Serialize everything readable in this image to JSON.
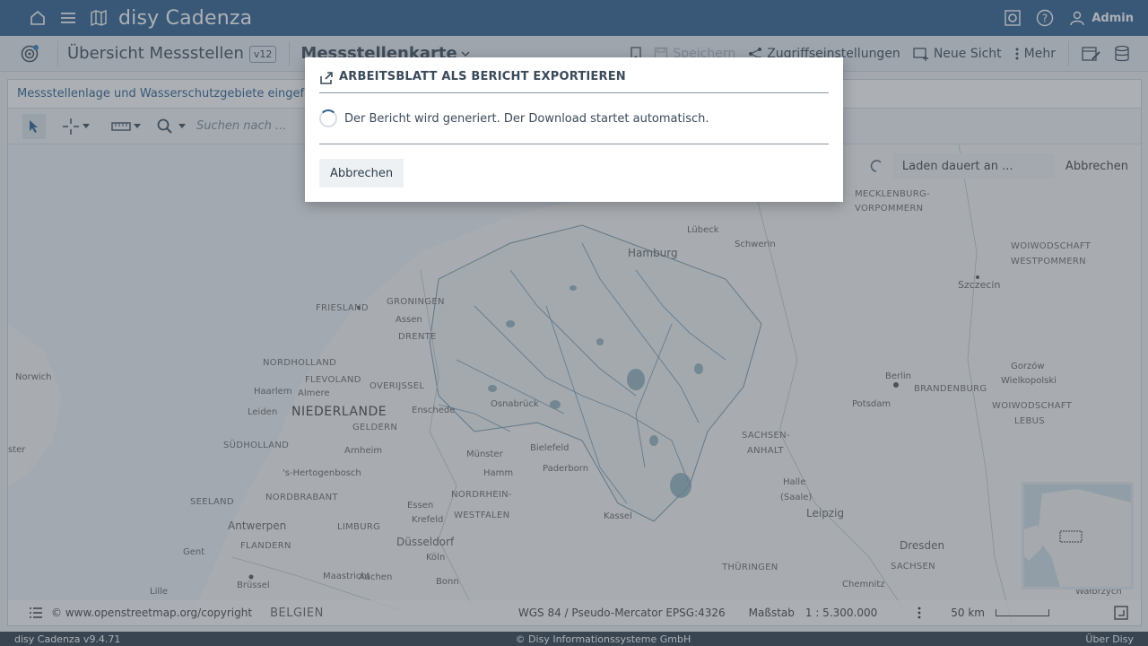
{
  "appbar": {
    "brand": "disy Cadenza",
    "user": "Admin",
    "icons": [
      "home-icon",
      "menu-icon",
      "map-icon",
      "settings-icon",
      "help-icon",
      "user-icon"
    ]
  },
  "toolbar": {
    "workbook_title": "Übersicht Messstellen",
    "version": "v12",
    "view_title": "Messstellenkarte",
    "save_label": "Speichern",
    "access_label": "Zugriffseinstellungen",
    "new_view_label": "Neue Sicht",
    "more_label": "Mehr"
  },
  "panel": {
    "title": "Messstellenlage und Wasserschutzgebiete eingefärbt",
    "search_placeholder": "Suchen nach ...",
    "loading_text": "Laden dauert an ...",
    "loading_cancel": "Abbrechen"
  },
  "map": {
    "labels": {
      "hamburg": "Hamburg",
      "lubeck": "Lübeck",
      "schwerin": "Schwerin",
      "mv1": "MECKLENBURG-",
      "mv2": "VORPOMMERN",
      "groningen": "GRONINGEN",
      "friesland": "FRIESLAND",
      "assen": "Assen",
      "drente": "DRENTE",
      "nordholland": "NORDHOLLAND",
      "flevoland": "FLEVOLAND",
      "overijssel": "OVERIJSSEL",
      "haarlem": "Haarlem",
      "almere": "Almere",
      "niederlande": "NIEDERLANDE",
      "leiden": "Leiden",
      "geldern": "GELDERN",
      "enschede": "Enschede",
      "osnabruck": "Osnabrück",
      "sudholland": "SÜDHOLLAND",
      "arnheim": "Arnheim",
      "shertogenbosch": "'s-Hertogenbosch",
      "munster": "Münster",
      "bielefeld": "Bielefeld",
      "paderborn": "Paderborn",
      "hamm": "Hamm",
      "seeland": "SEELAND",
      "nordbrabant": "NORDBRABANT",
      "nrw1": "NORDRHEIN-",
      "nrw2": "WESTFALEN",
      "essen": "Essen",
      "krefeld": "Krefeld",
      "antwerpen": "Antwerpen",
      "limburg": "LIMBURG",
      "flandern": "FLANDERN",
      "gent": "Gent",
      "dusseldorf": "Düsseldorf",
      "koln": "Köln",
      "brussel": "Brüssel",
      "maastricht": "Maastricht",
      "aachen": "Aachen",
      "bonn": "Bonn",
      "lille": "Lille",
      "kassel": "Kassel",
      "sa1": "SACHSEN-",
      "sa2": "ANHALT",
      "halle": "Halle",
      "saale": "(Saale)",
      "leipzig": "Leipzig",
      "dresden": "Dresden",
      "sachsen": "SACHSEN",
      "thuringen": "THÜRINGEN",
      "chemnitz": "Chemnitz",
      "berlin": "Berlin",
      "potsdam": "Potsdam",
      "brandenburg": "BRANDENBURG",
      "szczecin": "Szczecin",
      "woi1": "WOIWODSCHAFT",
      "woi2": "WESTPOMMERN",
      "gorzow": "Gorzów",
      "wielkopolski": "Wielkopolski",
      "woi3": "WOIWODSCHAFT",
      "woi4": "LEBUS",
      "norwich": "Norwich",
      "ster": "ster",
      "walbrzych": "Wałbrzych"
    },
    "footer": {
      "copyright": "© www.openstreetmap.org/copyright",
      "belgien": "BELGIEN",
      "crs": "WGS 84 / Pseudo-Mercator EPSG:4326",
      "scale_label": "Maßstab",
      "scale_value": "1 : 5.300.000",
      "scalebar_label": "50 km"
    }
  },
  "dialog": {
    "title": "ARBEITSBLATT ALS BERICHT EXPORTIEREN",
    "message": "Der Bericht wird generiert. Der Download startet automatisch.",
    "cancel_label": "Abbrechen"
  },
  "statusbar": {
    "version": "disy Cadenza v9.4.71",
    "copyright": "© Disy Informationssysteme GmbH",
    "about": "Über Disy"
  }
}
